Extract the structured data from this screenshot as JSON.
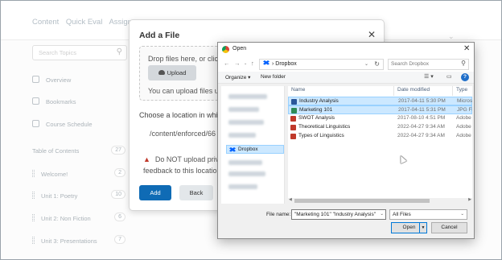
{
  "colors": {
    "primary_button": "#0f6bb5",
    "selection": "#cce8ff",
    "warning": "#c0392b",
    "dropbox": "#0061fe"
  },
  "lms": {
    "tabs": [
      "Content",
      "Quick Eval",
      "Assign"
    ],
    "search_placeholder": "Search Topics",
    "nav": [
      {
        "icon": "overview-icon",
        "label": "Overview"
      },
      {
        "icon": "bookmark-icon",
        "label": "Bookmarks"
      },
      {
        "icon": "calendar-icon",
        "label": "Course Schedule"
      }
    ],
    "toc_label": "Table of Contents",
    "toc_count": "27",
    "units": [
      {
        "label": "Welcome!",
        "count": "2"
      },
      {
        "label": "Unit 1: Poetry",
        "count": "10"
      },
      {
        "label": "Unit 2: Non Fiction",
        "count": "6"
      },
      {
        "label": "Unit 3: Presentations",
        "count": "7"
      }
    ]
  },
  "add_file": {
    "title": "Add a File",
    "drop_text": "Drop files here, or click",
    "upload_label": "Upload",
    "upload_help": "You can upload files up",
    "choose_location": "Choose a location in which",
    "path": "/content/enforced/66",
    "warning_line1": "Do NOT upload priv",
    "warning_line2": "feedback to this location",
    "add_label": "Add",
    "back_label": "Back"
  },
  "open_dialog": {
    "title": "Open",
    "address": "Dropbox",
    "search_placeholder": "Search Dropbox",
    "toolbar": {
      "organize": "Organize ▾",
      "new_folder": "New folder"
    },
    "sidebar_selected": "Dropbox",
    "columns": {
      "name": "Name",
      "date": "Date modified",
      "type": "Type"
    },
    "files": [
      {
        "name": "Industry Analysis",
        "date": "2017-04-11 5:30 PM",
        "type": "Microso",
        "selected": true,
        "icon_color": "#2b579a"
      },
      {
        "name": "Marketing 101",
        "date": "2017-04-11 5:31 PM",
        "type": "JPG File",
        "selected": true,
        "icon_color": "#2e8b57"
      },
      {
        "name": "SWOT Analysis",
        "date": "2017-08-10 4:51 PM",
        "type": "Adobe A",
        "selected": false,
        "icon_color": "#c0392b"
      },
      {
        "name": "Theoretical Linguistics",
        "date": "2022-04-27 9:34 AM",
        "type": "Adobe A",
        "selected": false,
        "icon_color": "#c0392b"
      },
      {
        "name": "Types of Linguistics",
        "date": "2022-04-27 9:34 AM",
        "type": "Adobe A",
        "selected": false,
        "icon_color": "#c0392b"
      }
    ],
    "file_name_label": "File name:",
    "file_name_value": "\"Marketing 101\" \"Industry Analysis\"",
    "filter_value": "All Files",
    "open_label": "Open",
    "cancel_label": "Cancel"
  }
}
